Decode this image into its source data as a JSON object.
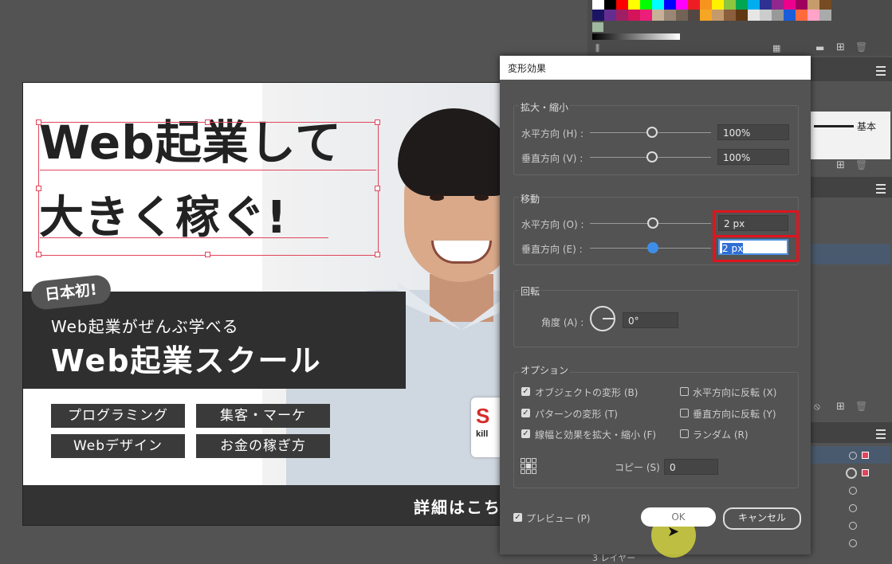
{
  "artboard": {
    "headline_line1": "Web起業して",
    "headline_line2": "大きく稼ぐ!",
    "badge": "日本初!",
    "subtitle": "Web起業がぜんぶ学べる",
    "school_name": "Web起業スクール",
    "tags": [
      "プログラミング",
      "集客・マーケ",
      "Webデザイン",
      "お金の稼ぎ方"
    ],
    "footer_text": "詳細はこち",
    "logo_letter": "S",
    "logo_sub": "kill"
  },
  "right_panel": {
    "stroke_label": "基本",
    "layers_count_label": "3 レイヤー"
  },
  "dialog": {
    "title": "変形効果",
    "scale_group": "拡大・縮小",
    "scale_h_label": "水平方向 (H) :",
    "scale_h_value": "100%",
    "scale_v_label": "垂直方向 (V) :",
    "scale_v_value": "100%",
    "move_group": "移動",
    "move_h_label": "水平方向 (O) :",
    "move_h_value": "2 px",
    "move_v_label": "垂直方向 (E) :",
    "move_v_value": "2 px",
    "rotate_group": "回転",
    "angle_label": "角度 (A) :",
    "angle_value": "0°",
    "options_group": "オプション",
    "opt_transform_objects": "オブジェクトの変形 (B)",
    "opt_transform_patterns": "パターンの変形 (T)",
    "opt_scale_strokes": "線幅と効果を拡大・縮小 (F)",
    "opt_reflect_x": "水平方向に反転 (X)",
    "opt_reflect_y": "垂直方向に反転 (Y)",
    "opt_random": "ランダム (R)",
    "copies_label": "コピー (S)",
    "copies_value": "0",
    "preview_label": "プレビュー (P)",
    "ok_label": "OK",
    "cancel_label": "キャンセル"
  },
  "colors": {
    "accent_blue": "#3d8ee8",
    "highlight_red": "#e0141e",
    "selection_red": "#e0455c",
    "swatches_row1": [
      "#ffffff",
      "#000000",
      "#ff0000",
      "#ffff00",
      "#00ff00",
      "#00ffff",
      "#0000ff",
      "#ff00ff",
      "#ee1d24",
      "#f7941d",
      "#fff200",
      "#8dc63f",
      "#00a651",
      "#00aeef",
      "#2e3192",
      "#92278f",
      "#ec008c",
      "#9e005d",
      "#c69c6d",
      "#754c24"
    ],
    "swatches_row2": [
      "#1b1464",
      "#662d91",
      "#9e1f63",
      "#d4145a",
      "#ed1e79",
      "#c7b299",
      "#998675",
      "#736357",
      "#534741",
      "#f5a623",
      "#c49a6c",
      "#8b5e3c",
      "#603813",
      "#e6e6e6",
      "#cccccc",
      "#999999",
      "#1a5dd8",
      "#ff6a3d",
      "#ffa3c8",
      "#aaaaaa"
    ]
  }
}
